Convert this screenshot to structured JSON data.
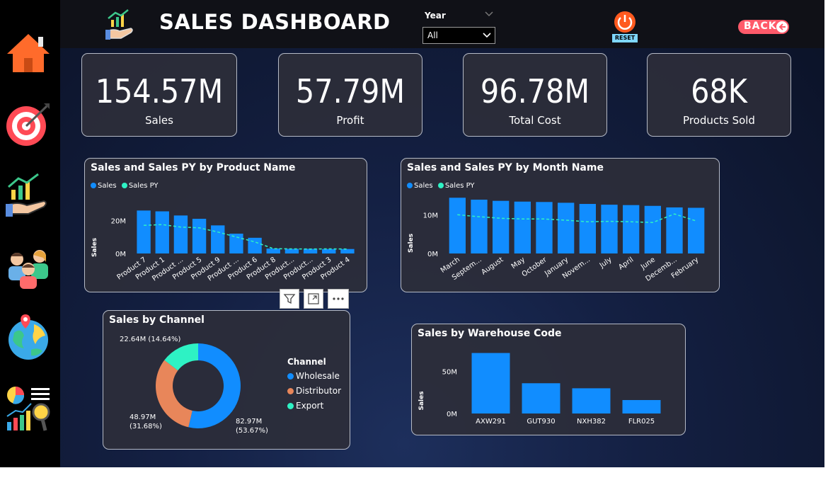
{
  "header": {
    "title": "SALES DASHBOARD",
    "year_label": "Year",
    "year_value": "All",
    "reset_label": "RESET",
    "back_label": "BACK"
  },
  "sidebar": {
    "icons": [
      "home-icon",
      "target-icon",
      "growth-hand-icon",
      "team-icon",
      "globe-map-icon",
      "analytics-icon"
    ]
  },
  "kpis": [
    {
      "value": "154.57M",
      "label": "Sales"
    },
    {
      "value": "57.79M",
      "label": "Profit"
    },
    {
      "value": "96.78M",
      "label": "Total Cost"
    },
    {
      "value": "68K",
      "label": "Products Sold"
    }
  ],
  "colors": {
    "sales": "#118dff",
    "sales_py": "#2ef2c4",
    "wholesale": "#118dff",
    "distributor": "#e8865a",
    "export": "#2ef2c4",
    "back": "#ff5a6a"
  },
  "chart_data": [
    {
      "type": "bar",
      "title": "Sales and Sales PY by Product Name",
      "ylabel": "Sales",
      "categories": [
        "Product 7",
        "Product 1",
        "Product ...",
        "Product 5",
        "Product 9",
        "Product ...",
        "Product 6",
        "Product 8",
        "Product...",
        "Product...",
        "Product 3",
        "Product 4"
      ],
      "series": [
        {
          "name": "Sales",
          "values": [
            26,
            25.5,
            23,
            21,
            17,
            12,
            9.5,
            3,
            2.8,
            2.8,
            2.7,
            2.7
          ]
        },
        {
          "name": "Sales PY",
          "values": [
            17,
            17.5,
            16,
            15.5,
            13,
            10,
            7,
            2.9,
            2.8,
            2.7,
            2.8,
            2.7
          ]
        }
      ],
      "yticks": [
        "0M",
        "20M"
      ],
      "ylim": [
        0,
        30
      ],
      "legend": "top-left"
    },
    {
      "type": "bar",
      "title": "Sales and Sales PY by Month Name",
      "ylabel": "Sales",
      "categories": [
        "March",
        "Septem...",
        "August",
        "May",
        "October",
        "January",
        "Novem...",
        "July",
        "April",
        "June",
        "Decemb...",
        "February"
      ],
      "series": [
        {
          "name": "Sales",
          "values": [
            14.4,
            13.9,
            13.6,
            13.4,
            13.3,
            13.1,
            12.8,
            12.6,
            12.5,
            12.3,
            11.9,
            11.8
          ]
        },
        {
          "name": "Sales PY",
          "values": [
            10,
            9.5,
            9.1,
            8.9,
            8.9,
            8.6,
            8.2,
            8.3,
            8.2,
            8.0,
            10.2,
            8.4
          ]
        }
      ],
      "yticks": [
        "0M",
        "10M"
      ],
      "ylim": [
        0,
        15
      ],
      "legend": "top-left"
    },
    {
      "type": "pie",
      "title": "Sales by Channel",
      "legend_title": "Channel",
      "slices": [
        {
          "name": "Wholesale",
          "value": 82.97,
          "percent": 53.67,
          "label": "82.97M",
          "pct_label": "(53.67%)"
        },
        {
          "name": "Distributor",
          "value": 48.97,
          "percent": 31.68,
          "label": "48.97M",
          "pct_label": "(31.68%)"
        },
        {
          "name": "Export",
          "value": 22.64,
          "percent": 14.64,
          "label": "22.64M (14.64%)"
        }
      ]
    },
    {
      "type": "bar",
      "title": "Sales by Warehouse Code",
      "ylabel": "Sales",
      "categories": [
        "AXW291",
        "GUT930",
        "NXH382",
        "FLR025"
      ],
      "values": [
        72,
        36,
        30,
        16
      ],
      "yticks": [
        "0M",
        "50M"
      ],
      "ylim": [
        0,
        75
      ]
    }
  ]
}
